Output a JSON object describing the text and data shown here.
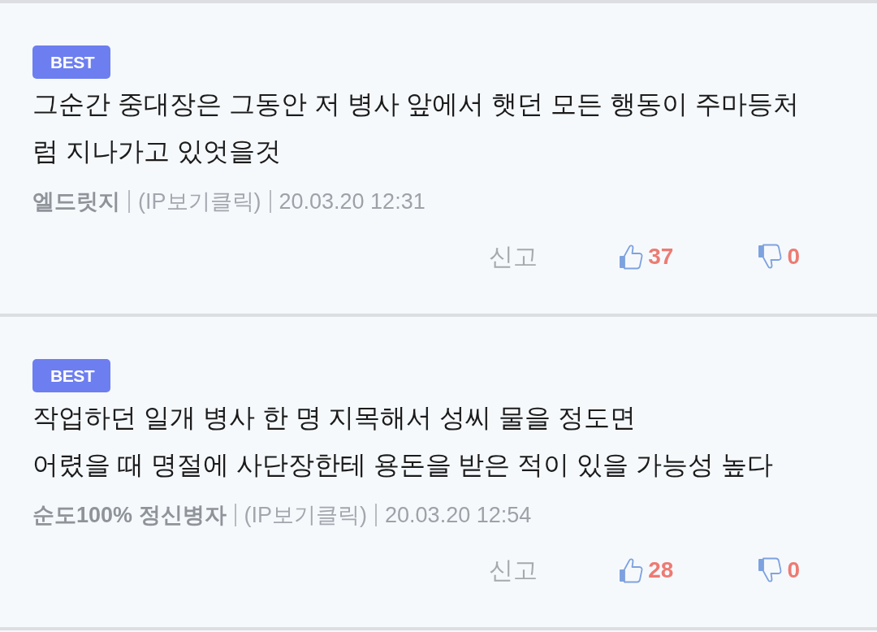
{
  "comments": [
    {
      "badge": "BEST",
      "text": "그순간 중대장은 그동안 저 병사 앞에서 햇던 모든 행동이 주마등처럼 지나가고 있엇을것",
      "author": "엘드릿지",
      "ip_link": "(IP보기클릭)",
      "date": "20.03.20 12:31",
      "report": "신고",
      "likes": "37",
      "dislikes": "0"
    },
    {
      "badge": "BEST",
      "text": "작업하던 일개 병사 한 명 지목해서 성씨 물을 정도면\n어렸을 때 명절에 사단장한테 용돈을 받은 적이 있을 가능성 높다",
      "author": "순도100% 정신병자",
      "ip_link": "(IP보기클릭)",
      "date": "20.03.20 12:54",
      "report": "신고",
      "likes": "28",
      "dislikes": "0"
    }
  ]
}
